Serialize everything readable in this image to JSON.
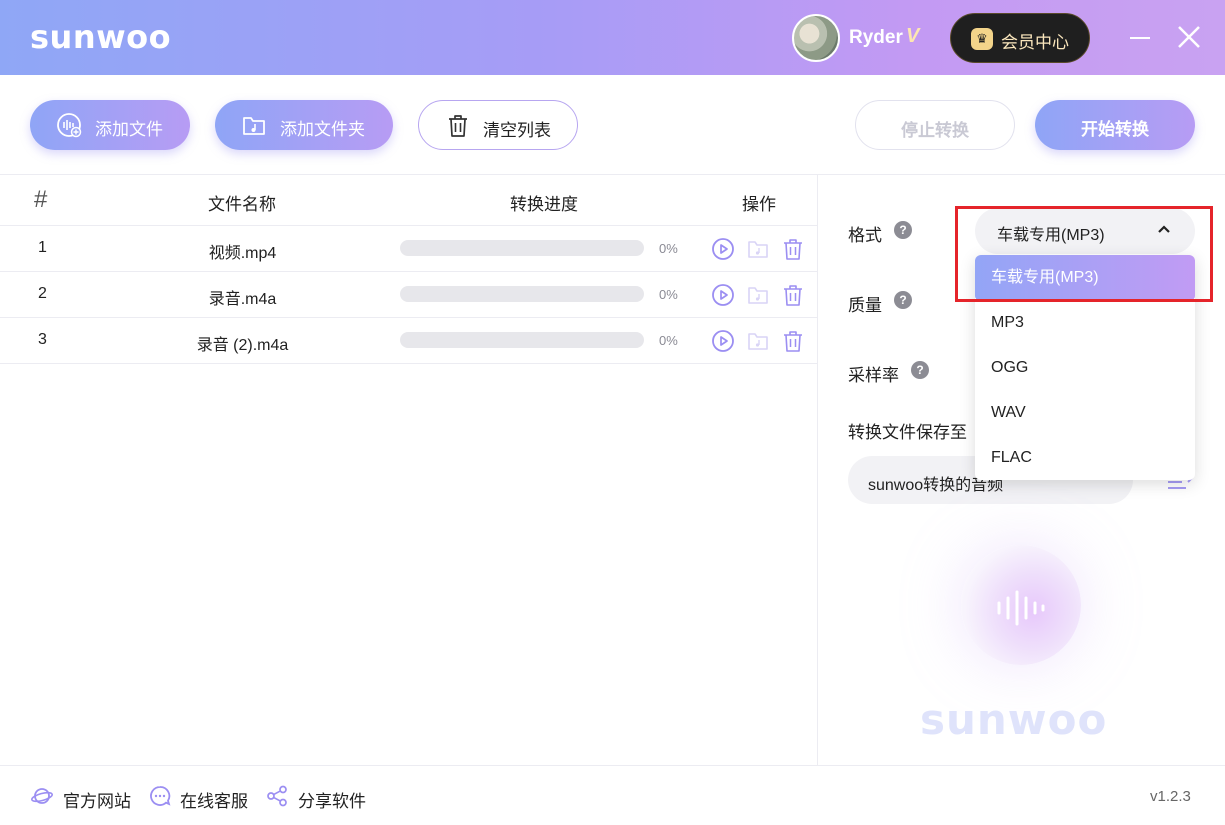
{
  "app": {
    "logo": "sunwoo",
    "user": {
      "name": "Ryder",
      "badge": "V"
    },
    "vip_button": "会员中心"
  },
  "toolbar": {
    "add_file": "添加文件",
    "add_folder": "添加文件夹",
    "clear_list": "清空列表",
    "stop": "停止转换",
    "start": "开始转换"
  },
  "table": {
    "headers": {
      "index": "#",
      "name": "文件名称",
      "progress": "转换进度",
      "actions": "操作"
    },
    "rows": [
      {
        "index": "1",
        "name": "视频.mp4",
        "progress": 0,
        "progress_text": "0%"
      },
      {
        "index": "2",
        "name": "录音.m4a",
        "progress": 0,
        "progress_text": "0%"
      },
      {
        "index": "3",
        "name": "录音 (2).m4a",
        "progress": 0,
        "progress_text": "0%"
      }
    ]
  },
  "settings": {
    "format_label": "格式",
    "quality_label": "质量",
    "sample_rate_label": "采样率",
    "save_to_label": "转换文件保存至",
    "format_selected": "车载专用(MP3)",
    "format_options": [
      "车载专用(MP3)",
      "MP3",
      "OGG",
      "WAV",
      "FLAC"
    ],
    "save_path": "sunwoo转换的音频"
  },
  "decor": {
    "logo": "sunwoo"
  },
  "footer": {
    "website": "官方网站",
    "support": "在线客服",
    "share": "分享软件",
    "version": "v1.2.3"
  },
  "colors": {
    "accent": "#a89cf5",
    "highlight_border": "#e5242a"
  }
}
